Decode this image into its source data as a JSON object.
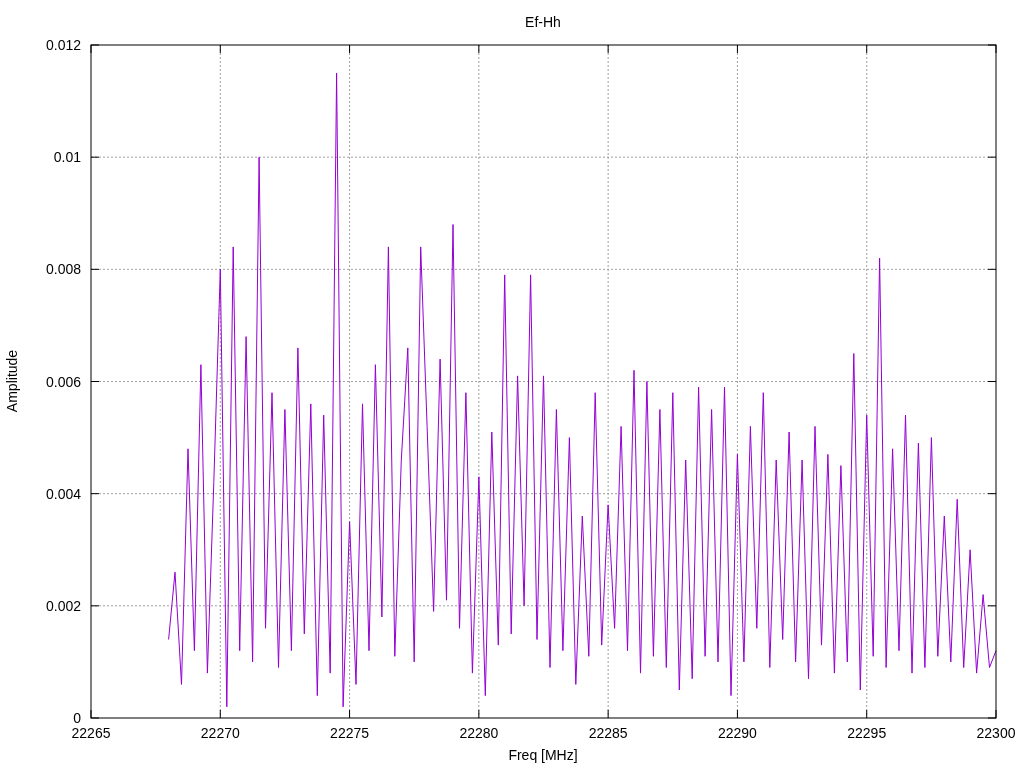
{
  "plot": {
    "chart_data": {
      "type": "line",
      "title": "Ef-Hh",
      "xlabel": "Freq [MHz]",
      "ylabel": "Amplitude",
      "grid": true,
      "xlim": [
        22265,
        22300
      ],
      "ylim": [
        0,
        0.012
      ],
      "xticks": [
        22265,
        22270,
        22275,
        22280,
        22285,
        22290,
        22295,
        22300
      ],
      "yticks": [
        0.012,
        0.01,
        0.008,
        0.006,
        0.004,
        0.002,
        0
      ],
      "x": [
        22268,
        22268.25,
        22268.5,
        22268.75,
        22269,
        22269.25,
        22269.5,
        22269.75,
        22270,
        22270.25,
        22270.5,
        22270.75,
        22271,
        22271.25,
        22271.5,
        22271.75,
        22272,
        22272.25,
        22272.5,
        22272.75,
        22273,
        22273.25,
        22273.5,
        22273.75,
        22274,
        22274.25,
        22274.5,
        22274.75,
        22275,
        22275.25,
        22275.5,
        22275.75,
        22276,
        22276.25,
        22276.5,
        22276.75,
        22277,
        22277.25,
        22277.5,
        22277.75,
        22278,
        22278.25,
        22278.5,
        22278.75,
        22279,
        22279.25,
        22279.5,
        22279.75,
        22280,
        22280.25,
        22280.5,
        22280.75,
        22281,
        22281.25,
        22281.5,
        22281.75,
        22282,
        22282.25,
        22282.5,
        22282.75,
        22283,
        22283.25,
        22283.5,
        22283.75,
        22284,
        22284.25,
        22284.5,
        22284.75,
        22285,
        22285.25,
        22285.5,
        22285.75,
        22286,
        22286.25,
        22286.5,
        22286.75,
        22287,
        22287.25,
        22287.5,
        22287.75,
        22288,
        22288.25,
        22288.5,
        22288.75,
        22289,
        22289.25,
        22289.5,
        22289.75,
        22290,
        22290.25,
        22290.5,
        22290.75,
        22291,
        22291.25,
        22291.5,
        22291.75,
        22292,
        22292.25,
        22292.5,
        22292.75,
        22293,
        22293.25,
        22293.5,
        22293.75,
        22294,
        22294.25,
        22294.5,
        22294.75,
        22295,
        22295.25,
        22295.5,
        22295.75,
        22296,
        22296.25,
        22296.5,
        22296.75,
        22297,
        22297.25,
        22297.5,
        22297.75,
        22298,
        22298.25,
        22298.5,
        22298.75,
        22299,
        22299.25,
        22299.5,
        22299.75,
        22300
      ],
      "series": [
        {
          "color": "#9400d3",
          "values": [
            0.0014,
            0.0026,
            0.0006,
            0.0048,
            0.0012,
            0.0063,
            0.0008,
            0.0042,
            0.008,
            0.0002,
            0.0084,
            0.0012,
            0.0068,
            0.001,
            0.01,
            0.0016,
            0.0058,
            0.0009,
            0.0055,
            0.0012,
            0.0066,
            0.0015,
            0.0056,
            0.0004,
            0.0054,
            0.0008,
            0.0115,
            0.0002,
            0.0035,
            0.0006,
            0.0056,
            0.0012,
            0.0063,
            0.0018,
            0.0084,
            0.0011,
            0.0046,
            0.0066,
            0.001,
            0.0084,
            0.0052,
            0.0019,
            0.0064,
            0.0021,
            0.0088,
            0.0016,
            0.0058,
            0.0008,
            0.0043,
            0.0004,
            0.0051,
            0.0013,
            0.0079,
            0.0015,
            0.0061,
            0.002,
            0.0079,
            0.0014,
            0.0061,
            0.0009,
            0.0055,
            0.0012,
            0.005,
            0.0006,
            0.0036,
            0.0011,
            0.0058,
            0.0013,
            0.0038,
            0.0016,
            0.0052,
            0.0012,
            0.0062,
            0.0008,
            0.006,
            0.0011,
            0.0055,
            0.0009,
            0.0058,
            0.0005,
            0.0046,
            0.0007,
            0.0059,
            0.0011,
            0.0055,
            0.001,
            0.0059,
            0.0004,
            0.0047,
            0.001,
            0.0052,
            0.0016,
            0.0058,
            0.0009,
            0.0046,
            0.0014,
            0.0051,
            0.001,
            0.0046,
            0.0007,
            0.0052,
            0.0013,
            0.0047,
            0.0008,
            0.0045,
            0.001,
            0.0065,
            0.0005,
            0.0054,
            0.0011,
            0.0082,
            0.0009,
            0.0048,
            0.0012,
            0.0054,
            0.0008,
            0.0049,
            0.0009,
            0.005,
            0.0011,
            0.0036,
            0.001,
            0.0039,
            0.0009,
            0.003,
            0.0008,
            0.0022,
            0.0009,
            0.0012
          ]
        }
      ]
    }
  }
}
